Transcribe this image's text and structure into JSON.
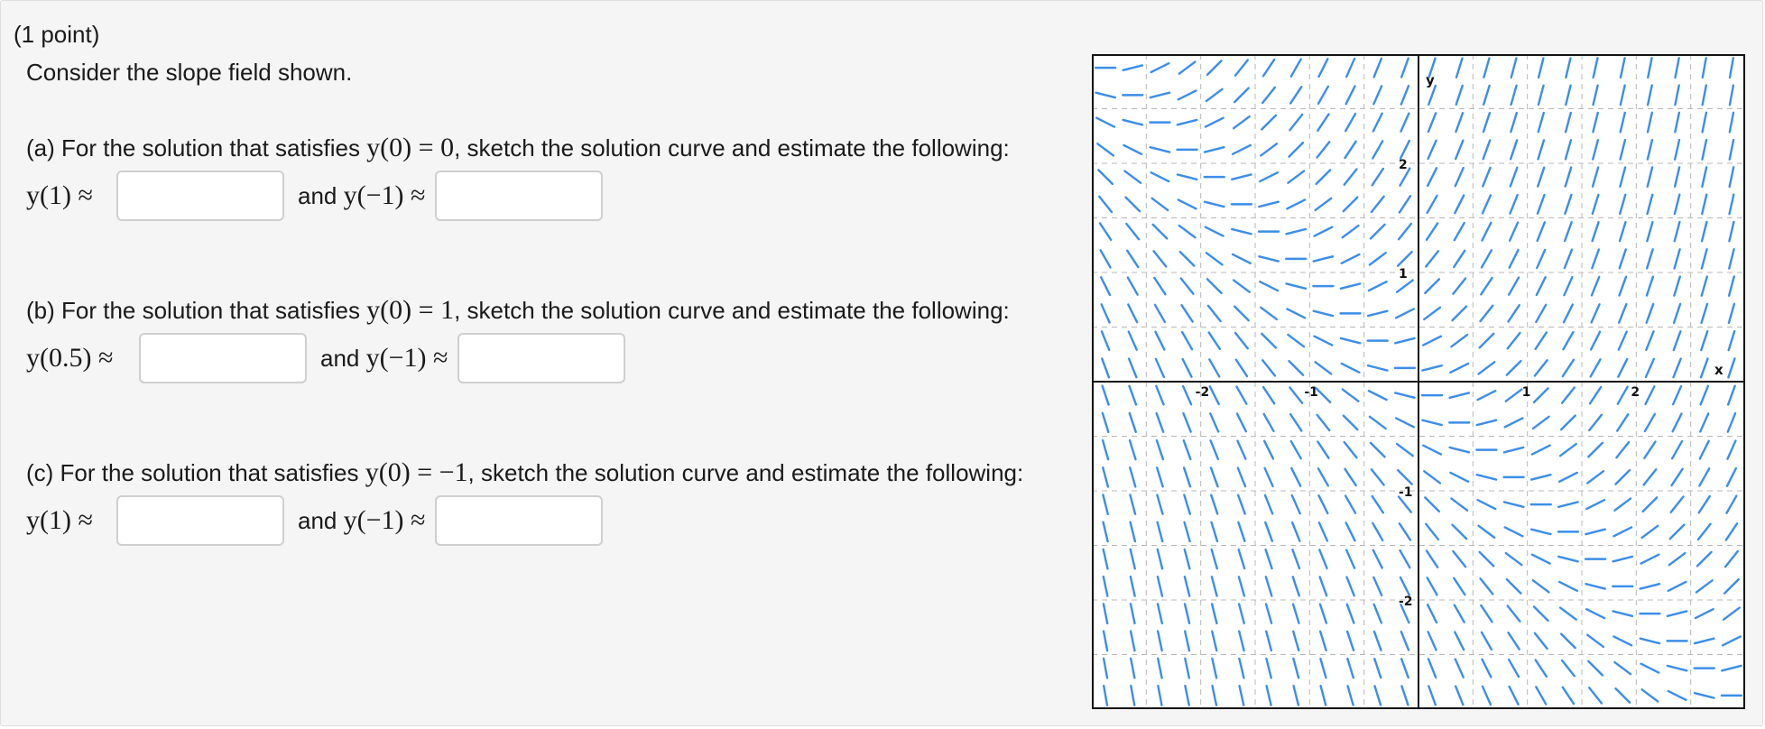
{
  "problem": {
    "points": "(1 point)",
    "intro": "Consider the slope field shown."
  },
  "parts": [
    {
      "prompt_start": "(a) For the solution that satisfies ",
      "condition": "y(0) = 0",
      "prompt_end": ", sketch the solution curve and estimate the following:",
      "label_1": "y(1) ≈",
      "and_word": "and ",
      "label_2": "y(−1) ≈",
      "value_1": "",
      "value_2": ""
    },
    {
      "prompt_start": "(b) For the solution that satisfies ",
      "condition": "y(0) = 1",
      "prompt_end": ", sketch the solution curve and estimate the following:",
      "label_1": "y(0.5) ≈",
      "and_word": "and ",
      "label_2": "y(−1) ≈",
      "value_1": "",
      "value_2": ""
    },
    {
      "prompt_start": "(c) For the solution that satisfies ",
      "condition": "y(0) = −1",
      "prompt_end": ", sketch the solution curve and estimate the following:",
      "label_1": "y(1) ≈",
      "and_word": "and ",
      "label_2": "y(−1) ≈",
      "value_1": "",
      "value_2": ""
    }
  ],
  "slope_field": {
    "x_axis_label": "x",
    "y_axis_label": "y",
    "x_range": [
      -3,
      3
    ],
    "y_range": [
      -3,
      3
    ],
    "x_tick_labels": [
      "-2",
      "-1",
      "1",
      "2"
    ],
    "y_tick_labels": [
      "2",
      "1",
      "-1",
      "-2"
    ],
    "grid": true,
    "colors": {
      "segment": "#3b8eea",
      "axis": "#111111",
      "grid": "#b8b8b8"
    }
  }
}
